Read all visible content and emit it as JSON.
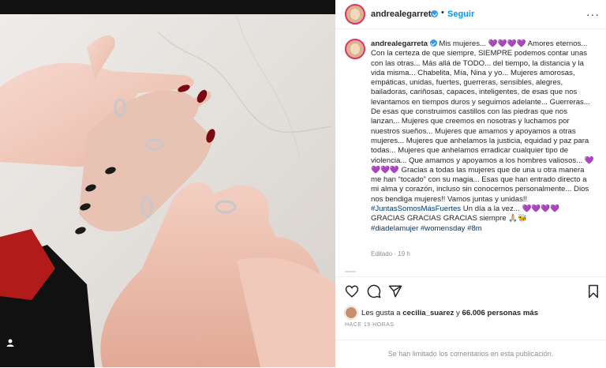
{
  "post": {
    "username": "andrealegarreta",
    "follow_label": "Seguir",
    "header_dot": "•",
    "more_label": "···",
    "caption": {
      "lines": [
        "Mis mujeres...",
        "Amores eternos... Con la certeza de que siempre, SIEMPRE podemos contar unas con las otras... Más allá de TODO... del tiempo, la distancia y la vida misma... Chabelita, Mía, Nina y yo...",
        "Mujeres amorosas, empáticas, unidas, fuertes, guerreras, sensibles, alegres, bailadoras, cariñosas, capaces, inteligentes, de esas que nos levantamos en tiempos duros y seguimos adelante... Guerreras... De esas que construimos castillos con las piedras que nos lanzan... Mujeres que creemos en nosotras y luchamos por nuestros sueños... Mujeres que amamos y apoyamos a otras mujeres... Mujeres que anhelamos la justicia, equidad y paz para todas... Mujeres que anhelamos erradicar cualquier tipo de violencia... Que amamos y apoyamos a los hombres valiosos...",
        "Gracias a todas las mujeres que de una u otra manera me han “tocado” con su magia... Esas que han entrado directo a mi alma y corazón, incluso sin conocernos personalmente... Dios nos bendiga mujeres!! Vamos juntas y unidas!!",
        "#JuntasSomosMásFuertes",
        "Un día a la vez...",
        "GRACIAS GRACIAS GRACIAS siempre",
        "#diadelamujer",
        "#womensday",
        "#8m"
      ],
      "hearts": "💜💜💜💜",
      "praying": "🙏🏼🐝"
    },
    "edited_label": "Editado",
    "edited_time": "19 h",
    "likes_prefix": "Les gusta a",
    "likes_user": "cecilia_suarez",
    "likes_and": "y",
    "likes_count": "66.006 personas más",
    "timestamp": "HACE 19 HORAS",
    "comments_notice": "Se han limitado los comentarios en esta publicación."
  },
  "icons": [
    "verified-icon",
    "like-icon",
    "comment-icon",
    "share-icon",
    "save-icon",
    "user-tag-icon"
  ],
  "colors": {
    "accent": "#0095f6",
    "text": "#262626",
    "muted": "#8e8e8e",
    "nails": "#7a0a12"
  }
}
